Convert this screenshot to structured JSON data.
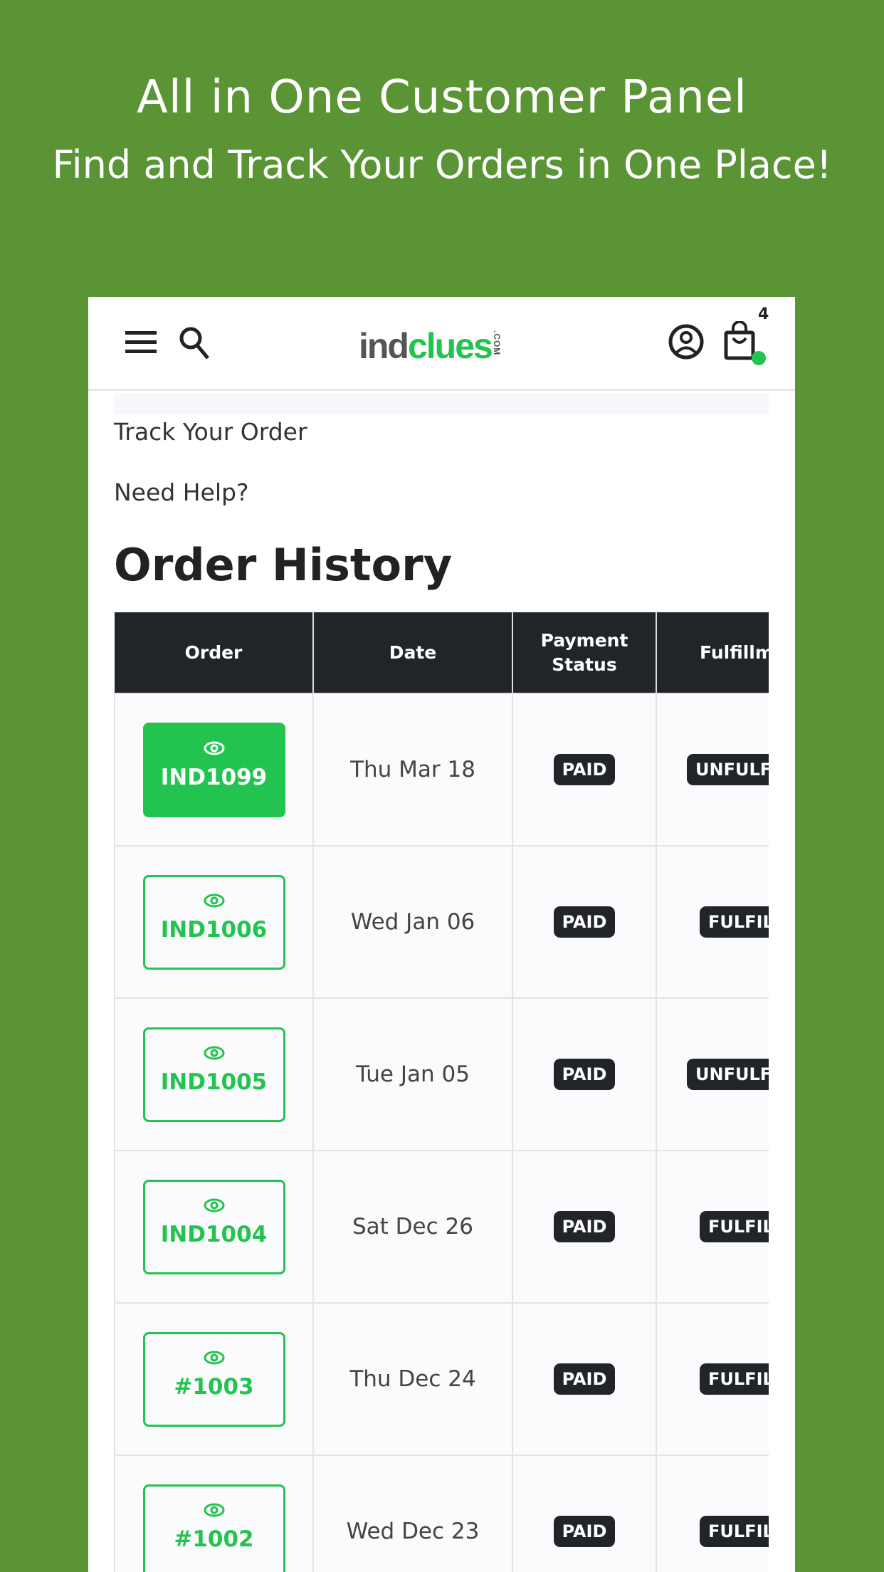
{
  "promo": {
    "title": "All in One Customer Panel",
    "subtitle": "Find and Track Your Orders in One Place!"
  },
  "header": {
    "logo_left": "ind",
    "logo_right": "clues",
    "logo_suffix": ".COM",
    "cart_count": "4",
    "accent": "#22c44f"
  },
  "links": {
    "track": "Track Your Order",
    "help": "Need Help?"
  },
  "page_title": "Order History",
  "table": {
    "columns": [
      "Order",
      "Date",
      "Payment Status",
      "Fulfillment Status"
    ],
    "rows": [
      {
        "order": "IND1099",
        "date": "Thu Mar 18",
        "payment": "PAID",
        "fulfillment": "UNFULFILLED",
        "active": true
      },
      {
        "order": "IND1006",
        "date": "Wed Jan 06",
        "payment": "PAID",
        "fulfillment": "FULFILLED"
      },
      {
        "order": "IND1005",
        "date": "Tue Jan 05",
        "payment": "PAID",
        "fulfillment": "UNFULFILLED"
      },
      {
        "order": "IND1004",
        "date": "Sat Dec 26",
        "payment": "PAID",
        "fulfillment": "FULFILLED"
      },
      {
        "order": "#1003",
        "date": "Thu Dec 24",
        "payment": "PAID",
        "fulfillment": "FULFILLED"
      },
      {
        "order": "#1002",
        "date": "Wed Dec 23",
        "payment": "PAID",
        "fulfillment": "FULFILLED"
      }
    ]
  }
}
